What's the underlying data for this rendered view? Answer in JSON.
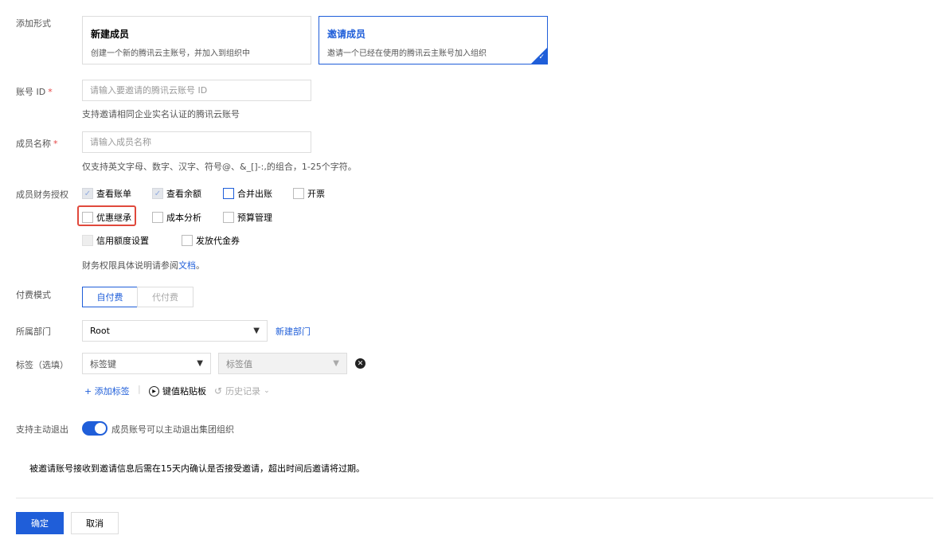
{
  "form": {
    "add_type": {
      "label": "添加形式",
      "options": [
        {
          "title": "新建成员",
          "desc": "创建一个新的腾讯云主账号，并加入到组织中"
        },
        {
          "title": "邀请成员",
          "desc": "邀请一个已经在使用的腾讯云主账号加入组织"
        }
      ],
      "selected": "邀请成员"
    },
    "account_id": {
      "label": "账号 ID",
      "required_mark": "*",
      "placeholder": "请输入要邀请的腾讯云账号 ID",
      "help": "支持邀请相同企业实名认证的腾讯云账号"
    },
    "member_name": {
      "label": "成员名称",
      "required_mark": "*",
      "placeholder": "请输入成员名称",
      "help": "仅支持英文字母、数字、汉字、符号@、&_[]-:,的组合，1-25个字符。"
    },
    "finance_auth": {
      "label": "成员财务授权",
      "options": [
        {
          "label": "查看账单",
          "checked": true,
          "disabled": true
        },
        {
          "label": "查看余额",
          "checked": true,
          "disabled": true
        },
        {
          "label": "合并出账",
          "checked": false,
          "disabled": false
        },
        {
          "label": "开票",
          "checked": false,
          "disabled": false
        },
        {
          "label": "优惠继承",
          "checked": false,
          "disabled": false
        },
        {
          "label": "成本分析",
          "checked": false,
          "disabled": false
        },
        {
          "label": "预算管理",
          "checked": false,
          "disabled": false
        },
        {
          "label": "信用额度设置",
          "checked": false,
          "disabled": true
        },
        {
          "label": "发放代金券",
          "checked": false,
          "disabled": false
        }
      ],
      "help_prefix": "财务权限具体说明请参阅",
      "help_link": "文档",
      "help_suffix": "。"
    },
    "payment_mode": {
      "label": "付费模式",
      "options": [
        "自付费",
        "代付费"
      ],
      "selected": "自付费"
    },
    "department": {
      "label": "所属部门",
      "value": "Root",
      "new_link": "新建部门"
    },
    "tags": {
      "label": "标签（选填）",
      "key_placeholder": "标签键",
      "value_placeholder": "标签值",
      "add_label": "添加标签",
      "clipboard_label": "键值粘贴板",
      "history_label": "历史记录"
    },
    "quit": {
      "label": "支持主动退出",
      "enabled": true,
      "desc": "成员账号可以主动退出集团组织"
    },
    "notice": "被邀请账号接收到邀请信息后需在15天内确认是否接受邀请，超出时间后邀请将过期。"
  },
  "actions": {
    "confirm": "确定",
    "cancel": "取消"
  },
  "colors": {
    "primary": "#1f5ed9",
    "required": "#e54545",
    "highlight": "#e0493c"
  }
}
